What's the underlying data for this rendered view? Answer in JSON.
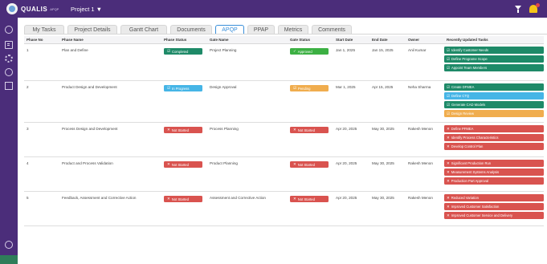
{
  "app": {
    "logo_text": "QUALIS",
    "logo_sub": "APQP",
    "project": "Project 1 ▼"
  },
  "colors": {
    "brand": "#4b2d7a",
    "completed": "#1e8a68",
    "in_progress": "#46b5e6",
    "not_started": "#d9534f",
    "approved": "#3cb043",
    "pending": "#f0ad4e",
    "active_tab": "#3a8fd9"
  },
  "tabs": [
    {
      "label": "My Tasks",
      "active": false
    },
    {
      "label": "Project Details",
      "active": false
    },
    {
      "label": "Gantt Chart",
      "active": false
    },
    {
      "label": "Documents",
      "active": false
    },
    {
      "label": "APQP",
      "active": true
    },
    {
      "label": "PPAP",
      "active": false
    },
    {
      "label": "Metrics",
      "active": false
    },
    {
      "label": "Comments",
      "active": false
    }
  ],
  "table": {
    "headers": {
      "phase_no": "Phase No",
      "phase_name": "Phase Name",
      "phase_status": "Phase Status",
      "gate_name": "Gate Name",
      "gate_status": "Gate Status",
      "start_date": "Start Date",
      "end_date": "End Date",
      "owner": "Owner",
      "tasks": "Recently Updated Tasks"
    },
    "rows": [
      {
        "phase_no": "1",
        "phase_name": "Plan and Define",
        "phase_status": "Completed",
        "phase_status_kind": "completed",
        "gate_name": "Project Planning",
        "gate_status": "Approved",
        "gate_status_kind": "approved",
        "start_date": "Jan 1, 2025",
        "end_date": "Jan 15, 2025",
        "owner": "Anil Kumar",
        "tasks": [
          {
            "label": "Identify Customer Needs",
            "kind": "completed"
          },
          {
            "label": "Define Programe Scope",
            "kind": "completed"
          },
          {
            "label": "Appoint Team Members",
            "kind": "completed"
          }
        ]
      },
      {
        "phase_no": "2",
        "phase_name": "Product Design and Development",
        "phase_status": "In Progress",
        "phase_status_kind": "in_progress",
        "gate_name": "Design Approval",
        "gate_status": "Pending",
        "gate_status_kind": "pending",
        "start_date": "Mar 1, 2025",
        "end_date": "Apr 15, 2025",
        "owner": "Neha Sharma",
        "tasks": [
          {
            "label": "Create DFMEA",
            "kind": "completed"
          },
          {
            "label": "Define CTQ",
            "kind": "in_progress"
          },
          {
            "label": "Generate CAD Models",
            "kind": "completed"
          },
          {
            "label": "Design Review",
            "kind": "pending"
          }
        ]
      },
      {
        "phase_no": "3",
        "phase_name": "Process Design and Development",
        "phase_status": "Not Started",
        "phase_status_kind": "not_started",
        "gate_name": "Process Planning",
        "gate_status": "Not Started",
        "gate_status_kind": "not_started",
        "start_date": "Apr 20, 2025",
        "end_date": "May 30, 2025",
        "owner": "Rakesh Menon",
        "tasks": [
          {
            "label": "Define PFMEA",
            "kind": "not_started"
          },
          {
            "label": "Identify Process Characteristics",
            "kind": "not_started"
          },
          {
            "label": "Develop Control Plan",
            "kind": "not_started"
          }
        ]
      },
      {
        "phase_no": "4",
        "phase_name": "Product and Process Validation",
        "phase_status": "Not Started",
        "phase_status_kind": "not_started",
        "gate_name": "Product Planning",
        "gate_status": "Not Started",
        "gate_status_kind": "not_started",
        "start_date": "Apr 20, 2025",
        "end_date": "May 30, 2025",
        "owner": "Rakesh Menon",
        "tasks": [
          {
            "label": "Significant Production Run",
            "kind": "not_started"
          },
          {
            "label": "Measurement Systems Analysis",
            "kind": "not_started"
          },
          {
            "label": "Production Part Approval",
            "kind": "not_started"
          }
        ]
      },
      {
        "phase_no": "5",
        "phase_name": "Feedback, Assessment and Corrective Action",
        "phase_status": "Not Started",
        "phase_status_kind": "not_started",
        "gate_name": "Assessment and Corrective Action",
        "gate_status": "Not Started",
        "gate_status_kind": "not_started",
        "start_date": "Apr 20, 2025",
        "end_date": "May 30, 2025",
        "owner": "Rakesh Menon",
        "tasks": [
          {
            "label": "Reduced Variation",
            "kind": "not_started"
          },
          {
            "label": "Improved Customer Satisfaction",
            "kind": "not_started"
          },
          {
            "label": "Improved Customer Service and Delivery",
            "kind": "not_started"
          }
        ]
      }
    ]
  }
}
